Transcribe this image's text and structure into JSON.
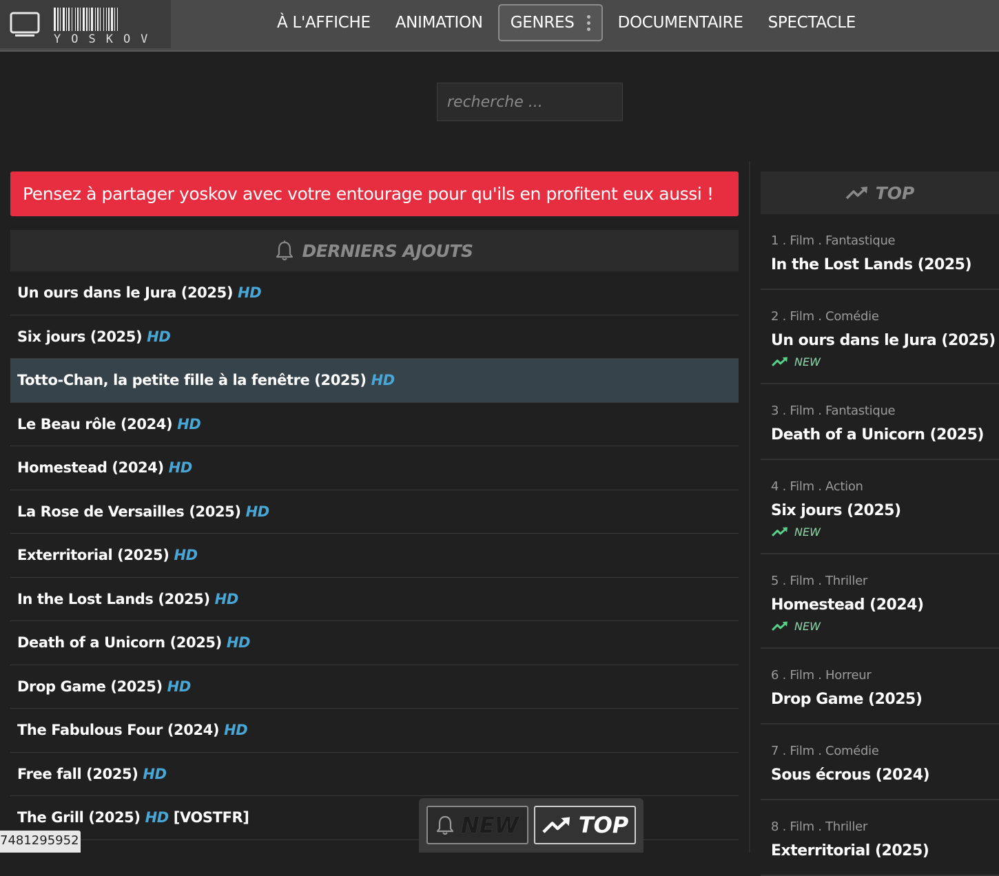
{
  "brand": {
    "name": "YOSKOV"
  },
  "nav": {
    "items": [
      "À L'AFFICHE",
      "ANIMATION"
    ],
    "genres_label": "GENRES",
    "items_after": [
      "DOCUMENTAIRE",
      "SPECTACLE"
    ]
  },
  "search": {
    "placeholder": "recherche ..."
  },
  "banner": {
    "text": "Pensez à partager yoskov avec votre entourage pour qu'ils en profitent eux aussi !"
  },
  "latest": {
    "title": "DERNIERS AJOUTS",
    "items": [
      {
        "title": "Un ours dans le Jura (2025)",
        "quality": "HD",
        "extra": ""
      },
      {
        "title": "Six jours (2025)",
        "quality": "HD",
        "extra": ""
      },
      {
        "title": "Totto-Chan, la petite fille à la fenêtre (2025)",
        "quality": "HD",
        "extra": ""
      },
      {
        "title": "Le Beau rôle (2024)",
        "quality": "HD",
        "extra": ""
      },
      {
        "title": "Homestead (2024)",
        "quality": "HD",
        "extra": ""
      },
      {
        "title": "La Rose de Versailles (2025)",
        "quality": "HD",
        "extra": ""
      },
      {
        "title": "Exterritorial (2025)",
        "quality": "HD",
        "extra": ""
      },
      {
        "title": "In the Lost Lands (2025)",
        "quality": "HD",
        "extra": ""
      },
      {
        "title": "Death of a Unicorn (2025)",
        "quality": "HD",
        "extra": ""
      },
      {
        "title": "Drop Game (2025)",
        "quality": "HD",
        "extra": ""
      },
      {
        "title": "The Fabulous Four (2024)",
        "quality": "HD",
        "extra": ""
      },
      {
        "title": "Free fall (2025)",
        "quality": "HD",
        "extra": ""
      },
      {
        "title": "The Grill (2025)",
        "quality": "HD",
        "extra": "[VOSTFR]"
      }
    ]
  },
  "top": {
    "title": "TOP",
    "items": [
      {
        "meta": "1 . Film . Fantastique",
        "title": "In the Lost Lands (2025)",
        "new": false
      },
      {
        "meta": "2 . Film . Comédie",
        "title": "Un ours dans le Jura (2025)",
        "new": true
      },
      {
        "meta": "3 . Film . Fantastique",
        "title": "Death of a Unicorn (2025)",
        "new": false
      },
      {
        "meta": "4 . Film . Action",
        "title": "Six jours (2025)",
        "new": true
      },
      {
        "meta": "5 . Film . Thriller",
        "title": "Homestead (2024)",
        "new": true
      },
      {
        "meta": "6 . Film . Horreur",
        "title": "Drop Game (2025)",
        "new": false
      },
      {
        "meta": "7 . Film . Comédie",
        "title": "Sous écrous (2024)",
        "new": false
      },
      {
        "meta": "8 . Film . Thriller",
        "title": "Exterritorial (2025)",
        "new": false
      }
    ],
    "new_label": "NEW"
  },
  "float_bar": {
    "new_label": "NEW",
    "top_label": "TOP"
  },
  "counter": "7481295952",
  "colors": {
    "accent_hd": "#48a7d6",
    "banner": "#e62e40",
    "new_green": "#5ad38a"
  }
}
